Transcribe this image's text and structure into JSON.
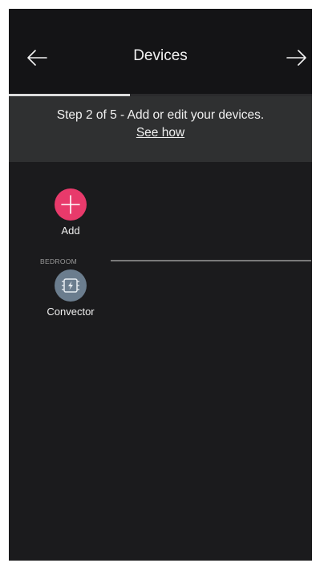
{
  "header": {
    "title": "Devices",
    "back_icon": "arrow-left-icon",
    "forward_icon": "arrow-right-icon"
  },
  "progress": {
    "current_step": 2,
    "total_steps": 5,
    "fraction": 0.4
  },
  "step_banner": {
    "text": "Step 2 of 5 - Add or edit your devices.",
    "link_label": "See how"
  },
  "add_device": {
    "label": "Add",
    "icon": "plus-icon",
    "color": "#e83a6b"
  },
  "rooms": [
    {
      "name": "BEDROOM",
      "devices": [
        {
          "label": "Convector",
          "icon": "convector-icon",
          "color": "#6b7d8e"
        }
      ]
    }
  ]
}
